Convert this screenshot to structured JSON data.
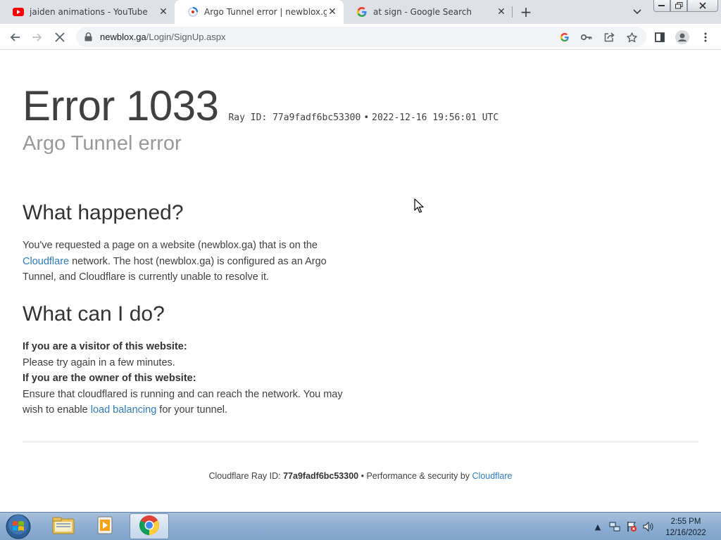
{
  "tabs": [
    {
      "title": "jaiden animations - YouTube",
      "favicon": "youtube-icon",
      "active": false
    },
    {
      "title": "Argo Tunnel error | newblox.ga | C",
      "favicon": "loading-icon",
      "active": true
    },
    {
      "title": "at sign - Google Search",
      "favicon": "google-icon",
      "active": false
    }
  ],
  "toolbar": {
    "url_host": "newblox.ga",
    "url_path": "/Login/SignUp.aspx"
  },
  "error": {
    "title": "Error 1033",
    "ray_label": "Ray ID: 77a9fadf6bc53300",
    "ray_sep": "•",
    "timestamp": "2022-12-16 19:56:01 UTC",
    "subtitle": "Argo Tunnel error"
  },
  "what_happened": {
    "heading": "What happened?",
    "text_1": "You've requested a page on a website (newblox.ga) that is on the",
    "link": "Cloudflare",
    "text_2": " network. The host (newblox.ga) is configured as an Argo Tunnel, and Cloudflare is currently unable to resolve it."
  },
  "what_can_i_do": {
    "heading": "What can I do?",
    "visitor_label": "If you are a visitor of this website:",
    "visitor_text": "Please try again in a few minutes.",
    "owner_label": "If you are the owner of this website:",
    "owner_text": "Ensure that cloudflared is running and can reach the network. You may wish to enable ",
    "owner_link": "load balancing",
    "owner_text_end": " for your tunnel."
  },
  "footer": {
    "ray_label": "Cloudflare Ray ID: ",
    "ray_id": "77a9fadf6bc53300",
    "sep": " • ",
    "perf_text": "Performance & security by ",
    "perf_link": "Cloudflare"
  },
  "taskbar": {
    "time": "2:55 PM",
    "date": "12/16/2022"
  },
  "colors": {
    "link": "#2f7bbf",
    "text": "#404040",
    "subtitle": "#999999",
    "taskbar": "#8fb0d2"
  }
}
